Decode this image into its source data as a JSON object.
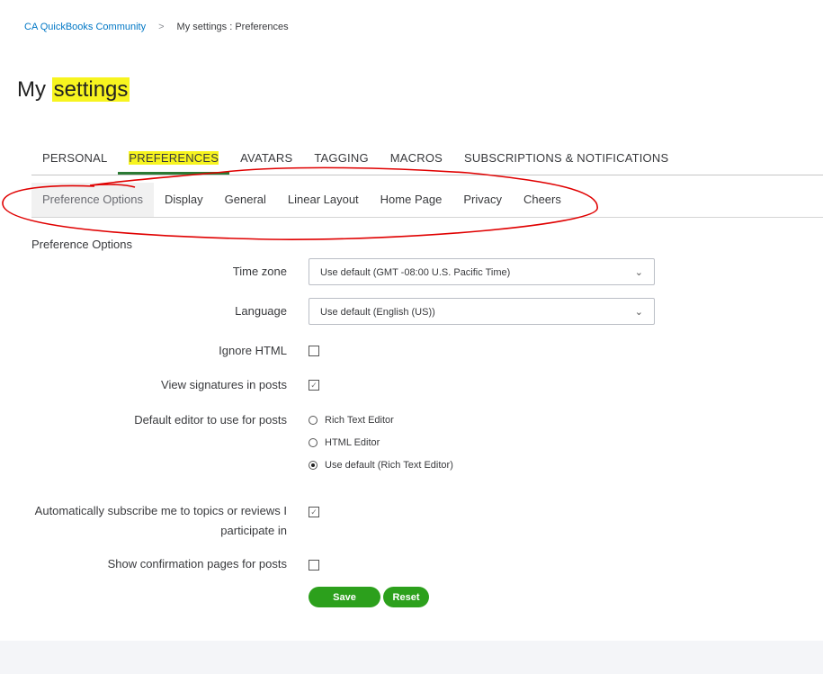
{
  "breadcrumb": {
    "home": "CA QuickBooks Community",
    "separator": ">",
    "current": "My settings : Preferences"
  },
  "title": {
    "prefix": "My ",
    "highlight": "settings"
  },
  "tabs": [
    "PERSONAL",
    "PREFERENCES",
    "AVATARS",
    "TAGGING",
    "MACROS",
    "SUBSCRIPTIONS & NOTIFICATIONS"
  ],
  "subtabs": [
    "Preference Options",
    "Display",
    "General",
    "Linear Layout",
    "Home Page",
    "Privacy",
    "Cheers"
  ],
  "section_title": "Preference Options",
  "form": {
    "timezone_label": "Time zone",
    "timezone_value": "Use default (GMT -08:00 U.S. Pacific Time)",
    "language_label": "Language",
    "language_value": "Use default (English (US))",
    "ignore_html_label": "Ignore HTML",
    "ignore_html": false,
    "signatures_label": "View signatures in posts",
    "signatures": true,
    "editor_label": "Default editor to use for posts",
    "editor_options": [
      "Rich Text Editor",
      "HTML Editor",
      "Use default (Rich Text Editor)"
    ],
    "editor_selected": 2,
    "autosub_label_1": "Automatically subscribe me to topics or reviews I",
    "autosub_label_2": "participate in",
    "autosub": true,
    "confirm_label": "Show confirmation pages for posts",
    "confirm": false
  },
  "buttons": {
    "save": "Save",
    "reset": "Reset"
  },
  "colors": {
    "accent": "#2ca01c",
    "highlight": "#f7f41f",
    "link": "#0077c5",
    "annotation": "#e00000"
  }
}
